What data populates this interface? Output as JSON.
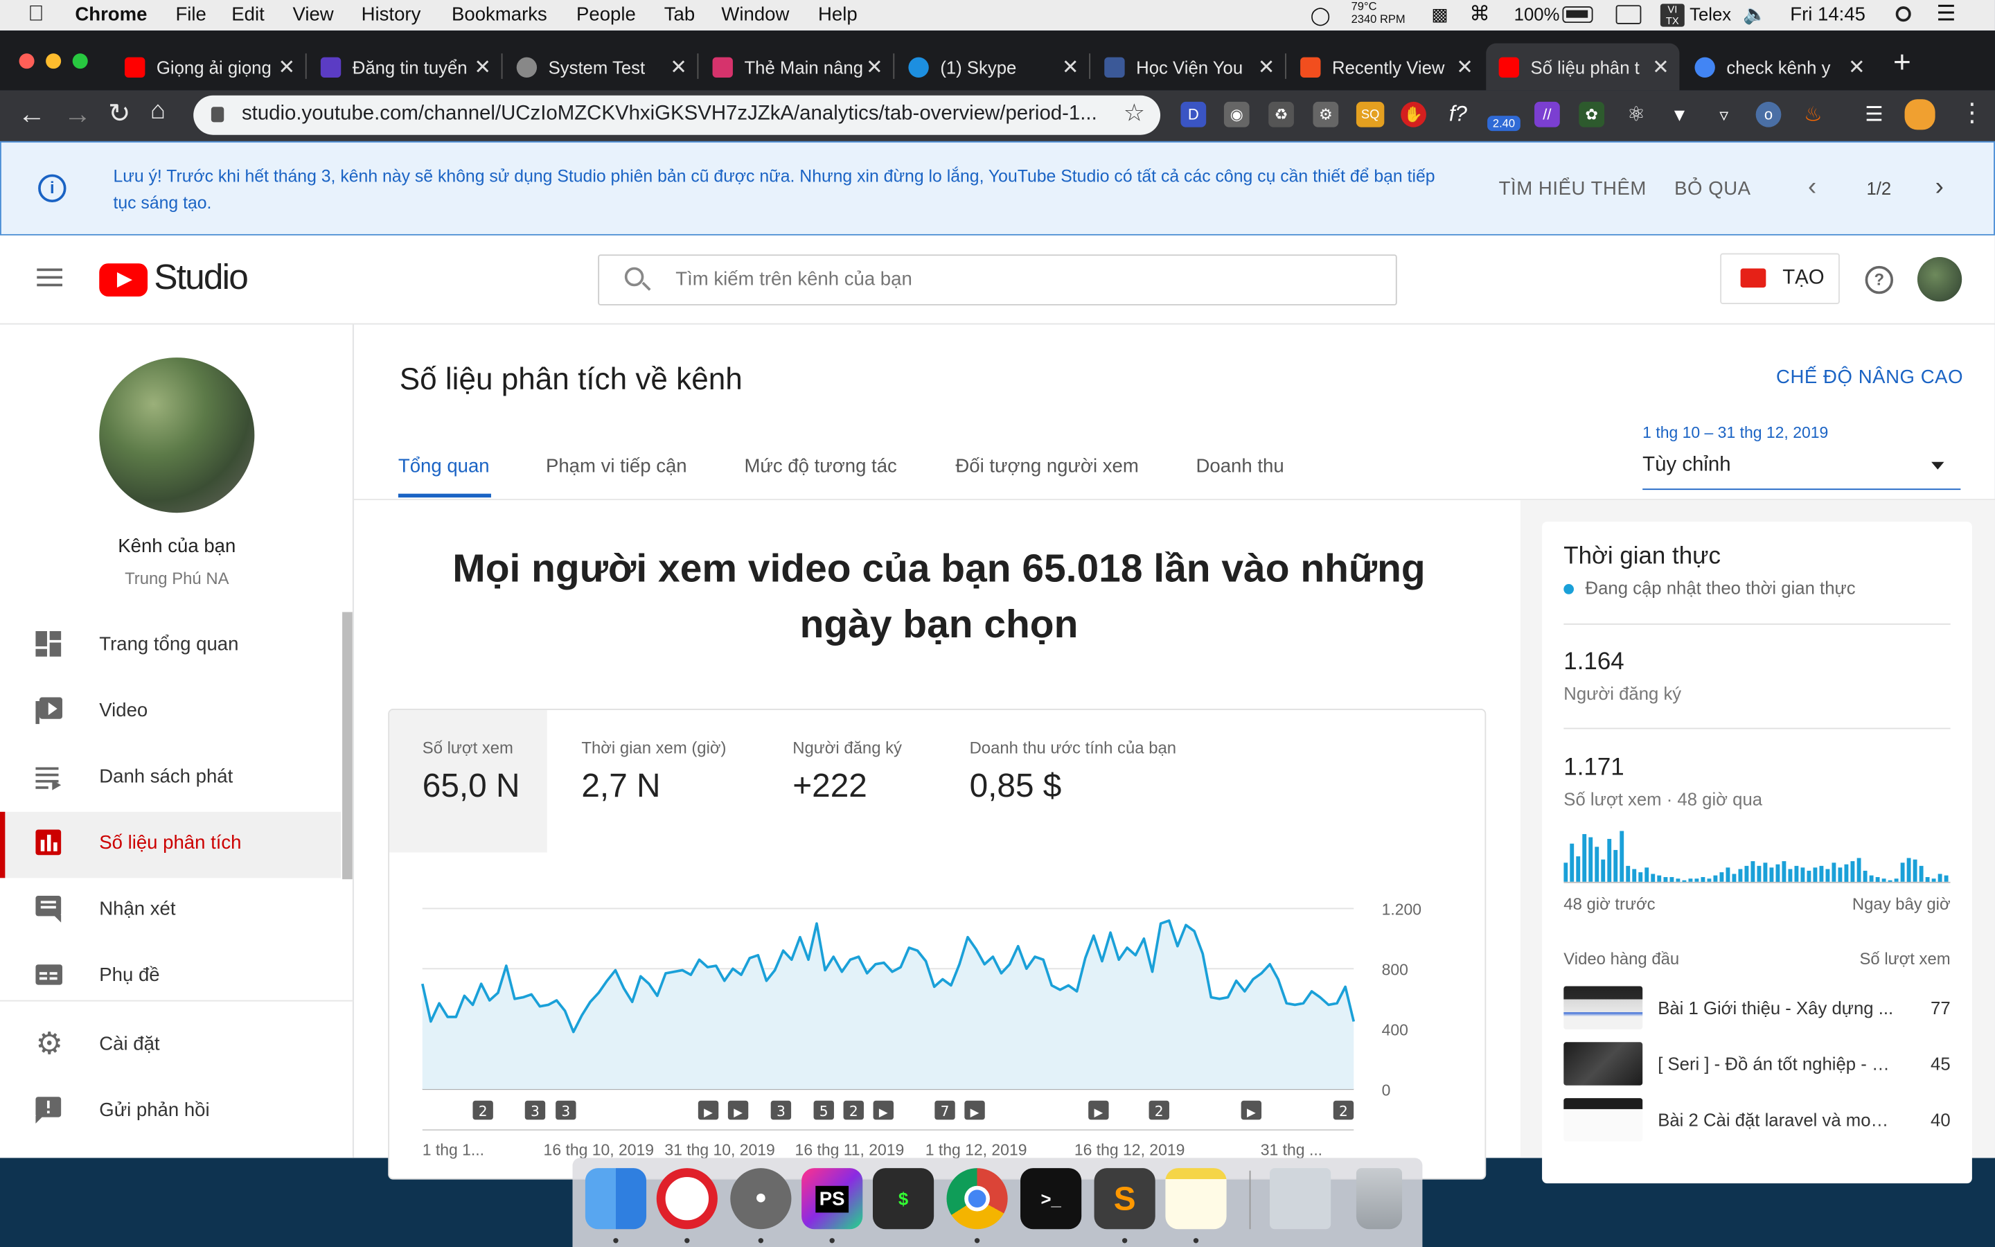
{
  "menubar": {
    "app": "Chrome",
    "items": [
      "File",
      "Edit",
      "View",
      "History",
      "Bookmarks",
      "People",
      "Tab",
      "Window",
      "Help"
    ],
    "temp": "79°C",
    "rpm": "2340 RPM",
    "battery": "100%",
    "input_method": "Telex",
    "clock": "Fri 14:45"
  },
  "tabs": [
    {
      "title": "Giọng ải giọng",
      "color": "#ff0000"
    },
    {
      "title": "Đăng tin tuyển",
      "color": "#5b3cc4"
    },
    {
      "title": "System Test",
      "color": "#888888"
    },
    {
      "title": "Thẻ Main nâng",
      "color": "#d6336c"
    },
    {
      "title": "(1) Skype",
      "color": "#1d8fe0"
    },
    {
      "title": "Học Viện You",
      "color": "#3b5998"
    },
    {
      "title": "Recently View",
      "color": "#f24e1e"
    },
    {
      "title": "Số liệu phân t",
      "color": "#ff0000"
    },
    {
      "title": "check kênh y",
      "color": "#4285f4"
    }
  ],
  "toolbar": {
    "url": "studio.youtube.com/channel/UCzIoMZCKVhxiGKSVH7zJZkA/analytics/tab-overview/period-1...",
    "ext_badge": "2.40"
  },
  "banner": {
    "text": "Lưu ý! Trước khi hết tháng 3, kênh này sẽ không sử dụng Studio phiên bản cũ được nữa. Nhưng xin đừng lo lắng, YouTube Studio có tất cả các công cụ cần thiết để bạn tiếp tục sáng tạo.",
    "learn_more": "TÌM HIỂU THÊM",
    "dismiss": "BỎ QUA",
    "pager": "1/2"
  },
  "header": {
    "logo_text": "Studio",
    "search_placeholder": "Tìm kiếm trên kênh của bạn",
    "create": "TẠO"
  },
  "sidebar": {
    "channel_label": "Kênh của bạn",
    "channel_name": "Trung Phú NA",
    "items": [
      {
        "label": "Trang tổng quan",
        "icon": "dashboard-icon"
      },
      {
        "label": "Video",
        "icon": "video-icon"
      },
      {
        "label": "Danh sách phát",
        "icon": "playlist-icon"
      },
      {
        "label": "Số liệu phân tích",
        "icon": "analytics-icon"
      },
      {
        "label": "Nhận xét",
        "icon": "comments-icon"
      },
      {
        "label": "Phụ đề",
        "icon": "subtitles-icon"
      },
      {
        "label": "Cài đặt",
        "icon": "settings-icon"
      },
      {
        "label": "Gửi phản hồi",
        "icon": "feedback-icon"
      }
    ]
  },
  "main": {
    "title": "Số liệu phân tích về kênh",
    "advanced": "CHẾ ĐỘ NÂNG CAO",
    "tabs": [
      "Tổng quan",
      "Phạm vi tiếp cận",
      "Mức độ tương tác",
      "Đối tượng người xem",
      "Doanh thu"
    ],
    "date_range": "1 thg 10 – 31 thg 12, 2019",
    "date_select": "Tùy chỉnh",
    "headline": "Mọi người xem video của bạn 65.018 lần vào những ngày bạn chọn",
    "metrics": [
      {
        "label": "Số lượt xem",
        "value": "65,0 N"
      },
      {
        "label": "Thời gian xem (giờ)",
        "value": "2,7 N"
      },
      {
        "label": "Người đăng ký",
        "value": "+222"
      },
      {
        "label": "Doanh thu ước tính của bạn",
        "value": "0,85 $"
      }
    ]
  },
  "realtime": {
    "title": "Thời gian thực",
    "subtitle": "Đang cập nhật theo thời gian thực",
    "subs_value": "1.164",
    "subs_label": "Người đăng ký",
    "views_value": "1.171",
    "views_label": "Số lượt xem · 48 giờ qua",
    "axis_left": "48 giờ trước",
    "axis_right": "Ngay bây giờ",
    "top_videos_label": "Video hàng đầu",
    "top_views_label": "Số lượt xem",
    "bars": [
      12,
      24,
      16,
      30,
      28,
      22,
      14,
      27,
      20,
      32,
      10,
      8,
      6,
      9,
      5,
      4,
      3,
      3,
      2,
      1,
      2,
      2,
      3,
      2,
      4,
      6,
      9,
      5,
      8,
      10,
      13,
      10,
      12,
      9,
      11,
      13,
      8,
      10,
      9,
      7,
      9,
      10,
      8,
      12,
      9,
      11,
      13,
      15,
      7,
      4,
      3,
      2,
      1,
      2,
      12,
      15,
      14,
      10,
      3,
      2,
      5,
      4
    ],
    "videos": [
      {
        "title": "Bài 1 Giới thiệu - Xây dựng ...",
        "views": "77"
      },
      {
        "title": "[ Seri ] - Đồ án tốt nghiệp - W...",
        "views": "45"
      },
      {
        "title": "Bài 2 Cài đặt laravel và mod...",
        "views": "40"
      }
    ]
  },
  "chart_data": {
    "type": "line",
    "series": [
      {
        "values": [
          700,
          450,
          570,
          480,
          480,
          620,
          560,
          700,
          590,
          640,
          820,
          600,
          610,
          630,
          550,
          560,
          590,
          520,
          380,
          490,
          580,
          640,
          720,
          790,
          670,
          580,
          750,
          700,
          620,
          770,
          780,
          790,
          760,
          860,
          810,
          820,
          720,
          800,
          760,
          870,
          890,
          720,
          790,
          920,
          860,
          1010,
          860,
          1100,
          790,
          880,
          780,
          860,
          880,
          770,
          830,
          840,
          780,
          810,
          940,
          920,
          850,
          680,
          730,
          690,
          830,
          1010,
          930,
          830,
          880,
          770,
          830,
          950,
          800,
          880,
          860,
          690,
          660,
          690,
          650,
          870,
          1020,
          850,
          1040,
          860,
          940,
          890,
          1000,
          780,
          1100,
          1120,
          950,
          1090,
          1050,
          900,
          610,
          600,
          610,
          720,
          650,
          730,
          770,
          830,
          730,
          570,
          560,
          570,
          650,
          610,
          560,
          570,
          680,
          450
        ]
      }
    ],
    "ylim": [
      0,
      1200
    ],
    "yticks": [
      "1.200",
      "800",
      "400",
      "0"
    ],
    "xticks": [
      "1 thg 1...",
      "16 thg 10, 2019",
      "31 thg 10, 2019",
      "16 thg 11, 2019",
      "1 thg 12, 2019",
      "16 thg 12, 2019",
      "31 thg ..."
    ],
    "markers": [
      {
        "pos": 0.065,
        "label": "2"
      },
      {
        "pos": 0.121,
        "label": "3"
      },
      {
        "pos": 0.154,
        "label": "3"
      },
      {
        "pos": 0.307,
        "label": "▶"
      },
      {
        "pos": 0.339,
        "label": "▶"
      },
      {
        "pos": 0.385,
        "label": "3"
      },
      {
        "pos": 0.431,
        "label": "5"
      },
      {
        "pos": 0.463,
        "label": "2"
      },
      {
        "pos": 0.495,
        "label": "▶"
      },
      {
        "pos": 0.561,
        "label": "7"
      },
      {
        "pos": 0.593,
        "label": "▶"
      },
      {
        "pos": 0.726,
        "label": "▶"
      },
      {
        "pos": 0.791,
        "label": "2"
      },
      {
        "pos": 0.89,
        "label": "▶"
      },
      {
        "pos": 0.989,
        "label": "2"
      }
    ]
  },
  "dock": {
    "apps": [
      {
        "name": "Finder",
        "color": "#2f7fe0"
      },
      {
        "name": "Opera",
        "color": "#e0202a"
      },
      {
        "name": "TablePlus",
        "color": "#6a6a6a"
      },
      {
        "name": "PhpStorm",
        "color": "#8a2be2"
      },
      {
        "name": "Terminal",
        "color": "#2b2b2b"
      },
      {
        "name": "Chrome",
        "color": "#e9e9e9"
      },
      {
        "name": "iTerm",
        "color": "#111111"
      },
      {
        "name": "Sublime Text",
        "color": "#ff9800"
      },
      {
        "name": "Notes",
        "color": "#f5d547"
      },
      {
        "name": "Preview",
        "color": "#d0d6dc"
      },
      {
        "name": "Trash",
        "color": "#b8bcc0"
      }
    ]
  }
}
